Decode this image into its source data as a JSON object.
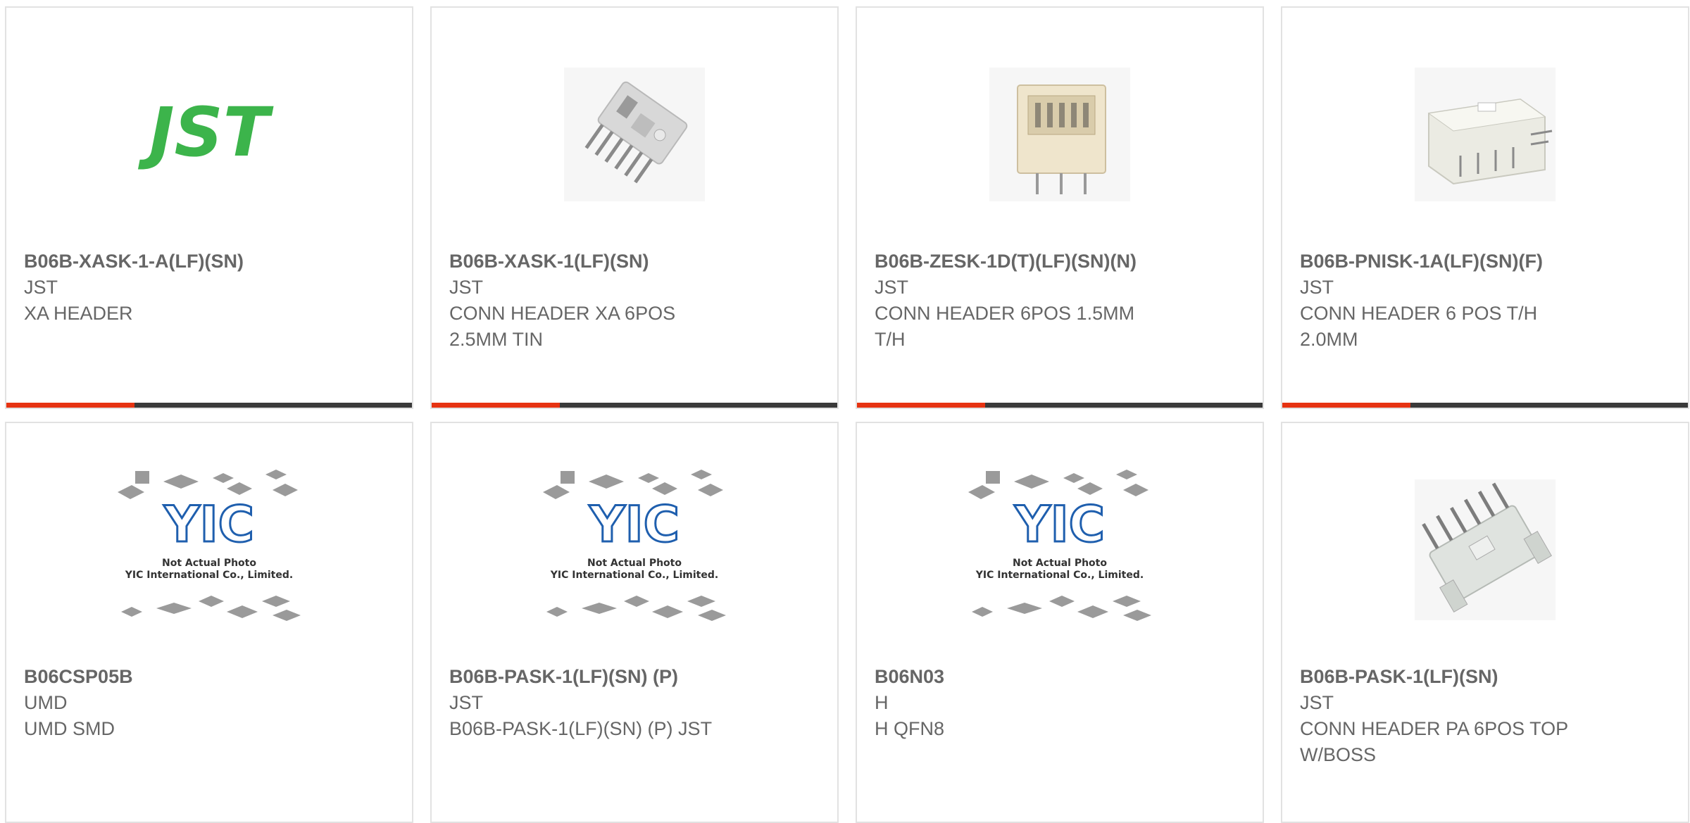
{
  "products": [
    {
      "part": "B06B-XASK-1-A(LF)(SN)",
      "mfr": "JST",
      "desc_l1": "XA HEADER",
      "desc_l2": "",
      "image": "jst-logo"
    },
    {
      "part": "B06B-XASK-1(LF)(SN)",
      "mfr": "JST",
      "desc_l1": "CONN HEADER XA 6POS",
      "desc_l2": "2.5MM TIN",
      "image": "connector-photo-gray"
    },
    {
      "part": "B06B-ZESK-1D(T)(LF)(SN)(N)",
      "mfr": "JST",
      "desc_l1": "CONN HEADER 6POS 1.5MM",
      "desc_l2": "T/H",
      "image": "connector-photo-beige"
    },
    {
      "part": "B06B-PNISK-1A(LF)(SN)(F)",
      "mfr": "JST",
      "desc_l1": "CONN HEADER 6 POS T/H",
      "desc_l2": "2.0MM",
      "image": "connector-photo-white"
    },
    {
      "part": "B06CSP05B",
      "mfr": "UMD",
      "desc_l1": "UMD SMD",
      "desc_l2": "",
      "image": "yic-placeholder"
    },
    {
      "part": "B06B-PASK-1(LF)(SN) (P)",
      "mfr": "JST",
      "desc_l1": "B06B-PASK-1(LF)(SN) (P) JST",
      "desc_l2": "",
      "image": "yic-placeholder"
    },
    {
      "part": "B06N03",
      "mfr": "H",
      "desc_l1": "H QFN8",
      "desc_l2": "",
      "image": "yic-placeholder"
    },
    {
      "part": "B06B-PASK-1(LF)(SN)",
      "mfr": "JST",
      "desc_l1": "CONN HEADER PA 6POS TOP",
      "desc_l2": "W/BOSS",
      "image": "connector-photo-gray-boss"
    }
  ],
  "logo": {
    "jst_text": "JST",
    "jst_color": "#3cb44b"
  },
  "placeholder": {
    "brand": "YIC",
    "line1": "Not Actual Photo",
    "line2": "YIC International Co., Limited."
  },
  "colors": {
    "accent_red": "#e63312",
    "accent_dark": "#3a3a3a",
    "border": "#e2e2e2"
  }
}
